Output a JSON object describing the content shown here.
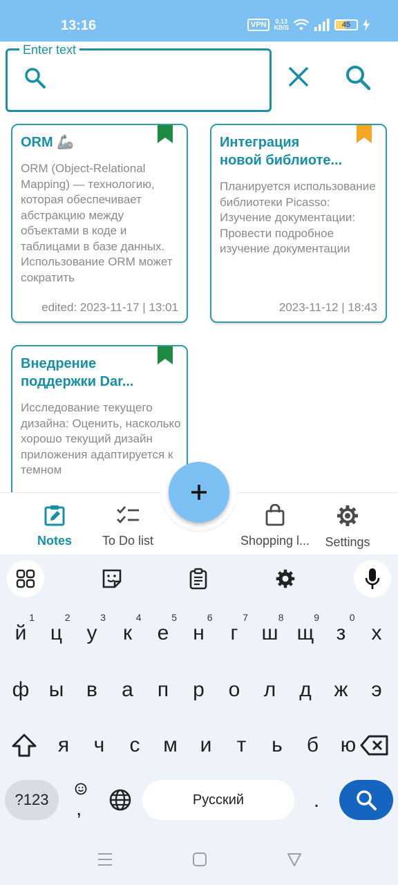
{
  "status_bar": {
    "time": "13:16",
    "vpn": "VPN",
    "speed_value": "0.13",
    "speed_unit": "KB/S",
    "battery": "45",
    "battery_level": 0.45
  },
  "search": {
    "label": "Enter text",
    "value": ""
  },
  "notes": [
    {
      "title_line1": "ORM 🦾",
      "title_line2": "",
      "body": "ORM (Object-Relational Mapping) — технологию, которая обеспечивает абстракцию между объектами в коде и таблицами в базе данных. Использование ORM может сократить",
      "date": "edited: 2023-11-17 | 13:01",
      "bookmark_color": "#1e8a44"
    },
    {
      "title_line1": "Интеграция",
      "title_line2": "новой библиоте...",
      "body": "Планируется использование библиотеки Picasso:  Изучение документации: Провести подробное изучение документации",
      "date": "2023-11-12 | 18:43",
      "bookmark_color": "#f5a623"
    },
    {
      "title_line1": "Внедрение",
      "title_line2": "поддержки Dar...",
      "body": "Исследование текущего дизайна: Оценить, насколько хорошо текущий дизайн приложения адаптируется к темном",
      "date": "",
      "bookmark_color": "#1e8a44"
    }
  ],
  "bottom_nav": {
    "notes": "Notes",
    "todo": "To Do list",
    "shopping": "Shopping l...",
    "settings": "Settings"
  },
  "keyboard": {
    "row1": [
      {
        "c": "й",
        "n": "1"
      },
      {
        "c": "ц",
        "n": "2"
      },
      {
        "c": "у",
        "n": "3"
      },
      {
        "c": "к",
        "n": "4"
      },
      {
        "c": "е",
        "n": "5"
      },
      {
        "c": "н",
        "n": "6"
      },
      {
        "c": "г",
        "n": "7"
      },
      {
        "c": "ш",
        "n": "8"
      },
      {
        "c": "щ",
        "n": "9"
      },
      {
        "c": "з",
        "n": "0"
      },
      {
        "c": "х",
        "n": ""
      }
    ],
    "row2": [
      "ф",
      "ы",
      "в",
      "а",
      "п",
      "р",
      "о",
      "л",
      "д",
      "ж",
      "э"
    ],
    "row3": [
      "я",
      "ч",
      "с",
      "м",
      "и",
      "т",
      "ь",
      "б",
      "ю"
    ],
    "symbols_key": "?123",
    "comma_key": ",",
    "space_label": "Русский",
    "period_key": "."
  },
  "colors": {
    "accent": "#178fa5",
    "status_bar": "#7cc0f4",
    "fab": "#7cc0f4",
    "enter_key": "#1565c0"
  },
  "icons": {
    "search_field": "search-icon",
    "clear": "close-icon",
    "search_action": "search-icon",
    "fab": "plus-icon",
    "nav_notes": "edit-note-icon",
    "nav_todo": "checklist-icon",
    "nav_shopping": "shopping-bag-icon",
    "nav_settings": "gear-icon"
  }
}
